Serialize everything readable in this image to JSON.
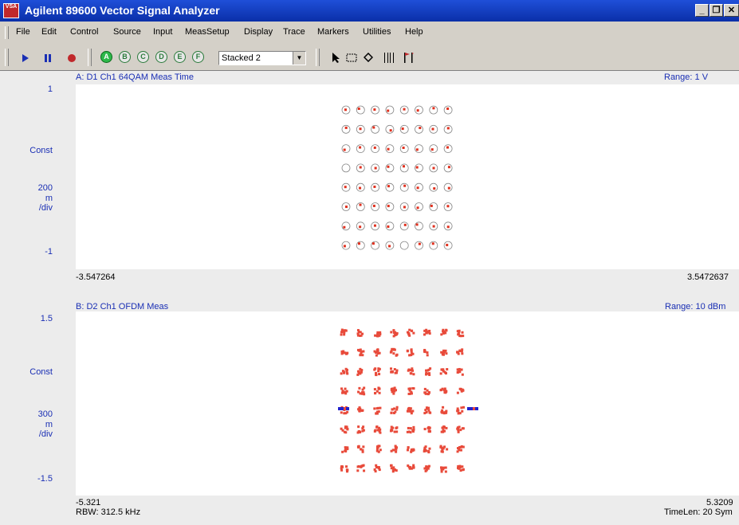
{
  "window": {
    "title": "Agilent 89600 Vector Signal Analyzer",
    "icon_text": "VSA",
    "buttons": [
      "minimize-icon",
      "restore-icon",
      "close-icon"
    ]
  },
  "menu": [
    "File",
    "Edit",
    "Control",
    "Source",
    "Input",
    "MeasSetup",
    "Display",
    "Trace",
    "Markers",
    "Utilities",
    "Help"
  ],
  "toolbar": {
    "play_icon": "play-icon",
    "pause_icon": "pause-icon",
    "record_icon": "record-icon",
    "traces": [
      {
        "label": "A",
        "active": true
      },
      {
        "label": "B",
        "active": false
      },
      {
        "label": "C",
        "active": false
      },
      {
        "label": "D",
        "active": false
      },
      {
        "label": "E",
        "active": false
      },
      {
        "label": "F",
        "active": false
      }
    ],
    "layout_value": "Stacked 2",
    "tools": [
      "pointer-icon",
      "marquee-icon",
      "diamond-marker-icon",
      "bars-icon",
      "marker-flag-icon"
    ]
  },
  "traceA": {
    "title": "A: D1 Ch1 64QAM Meas Time",
    "range": "Range: 1  V",
    "y_top": "1",
    "y_format": "Const",
    "y_scale": "200",
    "y_scale_unit": "m",
    "y_per_div": "/div",
    "y_bottom": "-1",
    "x_left": "-3.547264",
    "x_right": "3.5472637"
  },
  "traceB": {
    "title": "B: D2 Ch1 OFDM Meas",
    "range": "Range: 10 dBm",
    "y_top": "1.5",
    "y_format": "Const",
    "y_scale": "300",
    "y_scale_unit": "m",
    "y_per_div": "/div",
    "y_bottom": "-1.5",
    "x_left": "-5.321",
    "x_right": "5.3209",
    "footer_left": "RBW: 312.5 kHz",
    "footer_right": "TimeLen: 20  Sym"
  },
  "chart_data": [
    {
      "type": "scatter",
      "title": "A: D1 Ch1 64QAM Meas Time",
      "grid": "8x8 constellation",
      "ylim": [
        -1,
        1
      ],
      "xlim": [
        -3.547264,
        3.5472637
      ],
      "colors": {
        "ideal": "#888888",
        "measured": "#e0301e"
      }
    },
    {
      "type": "scatter",
      "title": "B: D2 Ch1 OFDM Meas",
      "grid": "8x8 constellation",
      "ylim": [
        -1.5,
        1.5
      ],
      "xlim": [
        -5.321,
        5.3209
      ],
      "colors": {
        "measured": "#e84a3a",
        "pilot": "#2222cc"
      }
    }
  ]
}
